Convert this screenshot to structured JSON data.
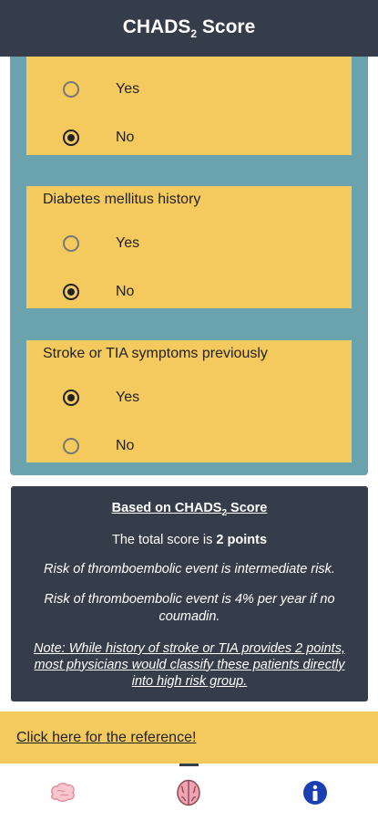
{
  "header": {
    "title_prefix": "CHADS",
    "title_sub": "2",
    "title_suffix": " Score"
  },
  "questions": [
    {
      "label": "",
      "options": [
        {
          "label": "Yes",
          "selected": false
        },
        {
          "label": "No",
          "selected": true
        }
      ]
    },
    {
      "label": "Diabetes mellitus history",
      "options": [
        {
          "label": "Yes",
          "selected": false
        },
        {
          "label": "No",
          "selected": true
        }
      ]
    },
    {
      "label": "Stroke or TIA symptoms previously",
      "options": [
        {
          "label": "Yes",
          "selected": true
        },
        {
          "label": "No",
          "selected": false
        }
      ]
    }
  ],
  "result": {
    "heading_prefix": "Based on CHADS",
    "heading_sub": "2",
    "heading_suffix": " Score",
    "total_prefix": "The total score is ",
    "total_value": "2 points",
    "risk_level": "Risk of thromboembolic event is intermediate risk.",
    "risk_rate": "Risk of thromboembolic event is 4% per year if no coumadin.",
    "note": "Note: While history of stroke or TIA provides 2 points, most physicians would classify these patients directly into high risk group."
  },
  "reference": {
    "link_label": "Click here for the reference!"
  },
  "tabs": [
    {
      "icon": "brain-outline-icon",
      "active": false
    },
    {
      "icon": "brain-filled-icon",
      "active": true
    },
    {
      "icon": "info-icon",
      "active": false
    }
  ],
  "colors": {
    "header": "#353c4a",
    "teal": "#6aa3ad",
    "card": "#f4c95d",
    "info": "#1a3fb0"
  }
}
